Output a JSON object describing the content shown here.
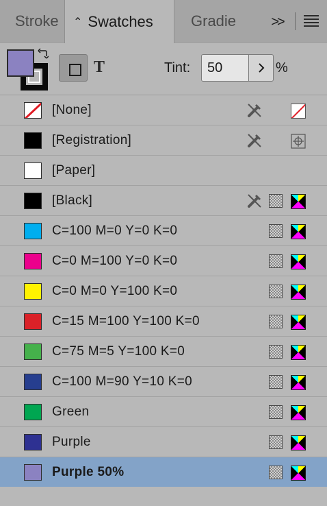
{
  "tabs": {
    "stroke": "Stroke",
    "swatches": "Swatches",
    "gradient": "Gradie",
    "more": ">>"
  },
  "toolbar": {
    "fill_color": "#8b82c1",
    "stroke_color": "#0a0a0a",
    "tint_label": "Tint:",
    "tint_value": "50",
    "tint_unit": "%"
  },
  "swatches": [
    {
      "label": "[None]",
      "color": "none",
      "non_editable": true,
      "spot_icon": false,
      "mode": "none"
    },
    {
      "label": "[Registration]",
      "color": "#000000",
      "non_editable": true,
      "spot_icon": false,
      "mode": "registration"
    },
    {
      "label": "[Paper]",
      "color": "#ffffff",
      "non_editable": false,
      "spot_icon": false,
      "mode": ""
    },
    {
      "label": "[Black]",
      "color": "#000000",
      "non_editable": true,
      "spot_icon": true,
      "mode": "cmyk"
    },
    {
      "label": "C=100 M=0 Y=0 K=0",
      "color": "#00aeef",
      "non_editable": false,
      "spot_icon": true,
      "mode": "cmyk"
    },
    {
      "label": "C=0 M=100 Y=0 K=0",
      "color": "#ec008c",
      "non_editable": false,
      "spot_icon": true,
      "mode": "cmyk"
    },
    {
      "label": "C=0 M=0 Y=100 K=0",
      "color": "#fff200",
      "non_editable": false,
      "spot_icon": true,
      "mode": "cmyk"
    },
    {
      "label": "C=15 M=100 Y=100 K=0",
      "color": "#da2128",
      "non_editable": false,
      "spot_icon": true,
      "mode": "cmyk"
    },
    {
      "label": "C=75 M=5 Y=100 K=0",
      "color": "#45b14b",
      "non_editable": false,
      "spot_icon": true,
      "mode": "cmyk"
    },
    {
      "label": "C=100 M=90 Y=10 K=0",
      "color": "#263e8f",
      "non_editable": false,
      "spot_icon": true,
      "mode": "cmyk"
    },
    {
      "label": "Green",
      "color": "#00a651",
      "non_editable": false,
      "spot_icon": true,
      "mode": "cmyk"
    },
    {
      "label": "Purple",
      "color": "#2e3192",
      "non_editable": false,
      "spot_icon": true,
      "mode": "cmyk"
    },
    {
      "label": "Purple 50%",
      "color": "#8b82c1",
      "non_editable": false,
      "spot_icon": true,
      "mode": "cmyk",
      "selected": true
    }
  ]
}
